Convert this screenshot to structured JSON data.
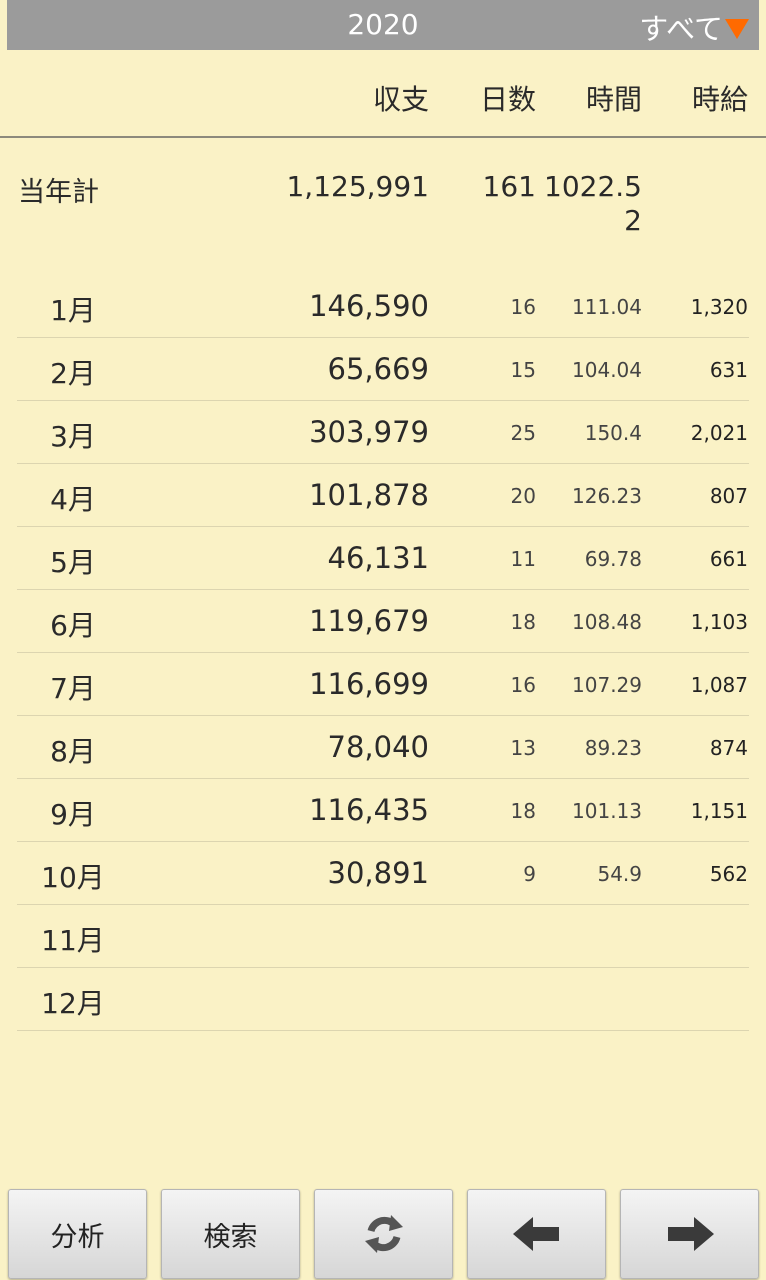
{
  "header": {
    "year": "2020",
    "filter_label": "すべて"
  },
  "columns": {
    "income": "収支",
    "days": "日数",
    "time": "時間",
    "wage": "時給"
  },
  "total": {
    "label": "当年計",
    "income": "1,125,991",
    "days": "161",
    "time": "1022.52"
  },
  "months": [
    {
      "month": "1月",
      "income": "146,590",
      "days": "16",
      "time": "111.04",
      "wage": "1,320"
    },
    {
      "month": "2月",
      "income": "65,669",
      "days": "15",
      "time": "104.04",
      "wage": "631"
    },
    {
      "month": "3月",
      "income": "303,979",
      "days": "25",
      "time": "150.4",
      "wage": "2,021"
    },
    {
      "month": "4月",
      "income": "101,878",
      "days": "20",
      "time": "126.23",
      "wage": "807"
    },
    {
      "month": "5月",
      "income": "46,131",
      "days": "11",
      "time": "69.78",
      "wage": "661"
    },
    {
      "month": "6月",
      "income": "119,679",
      "days": "18",
      "time": "108.48",
      "wage": "1,103"
    },
    {
      "month": "7月",
      "income": "116,699",
      "days": "16",
      "time": "107.29",
      "wage": "1,087"
    },
    {
      "month": "8月",
      "income": "78,040",
      "days": "13",
      "time": "89.23",
      "wage": "874"
    },
    {
      "month": "9月",
      "income": "116,435",
      "days": "18",
      "time": "101.13",
      "wage": "1,151"
    },
    {
      "month": "10月",
      "income": "30,891",
      "days": "9",
      "time": "54.9",
      "wage": "562"
    },
    {
      "month": "11月",
      "income": "",
      "days": "",
      "time": "",
      "wage": ""
    },
    {
      "month": "12月",
      "income": "",
      "days": "",
      "time": "",
      "wage": ""
    }
  ],
  "toolbar": {
    "analysis_label": "分析",
    "search_label": "検索",
    "refresh_icon": "refresh-icon",
    "prev_icon": "arrow-left-icon",
    "next_icon": "arrow-right-icon"
  },
  "colors": {
    "background": "#faf2c6",
    "topbar": "#9b9b9b",
    "accent": "#ff6a00"
  }
}
